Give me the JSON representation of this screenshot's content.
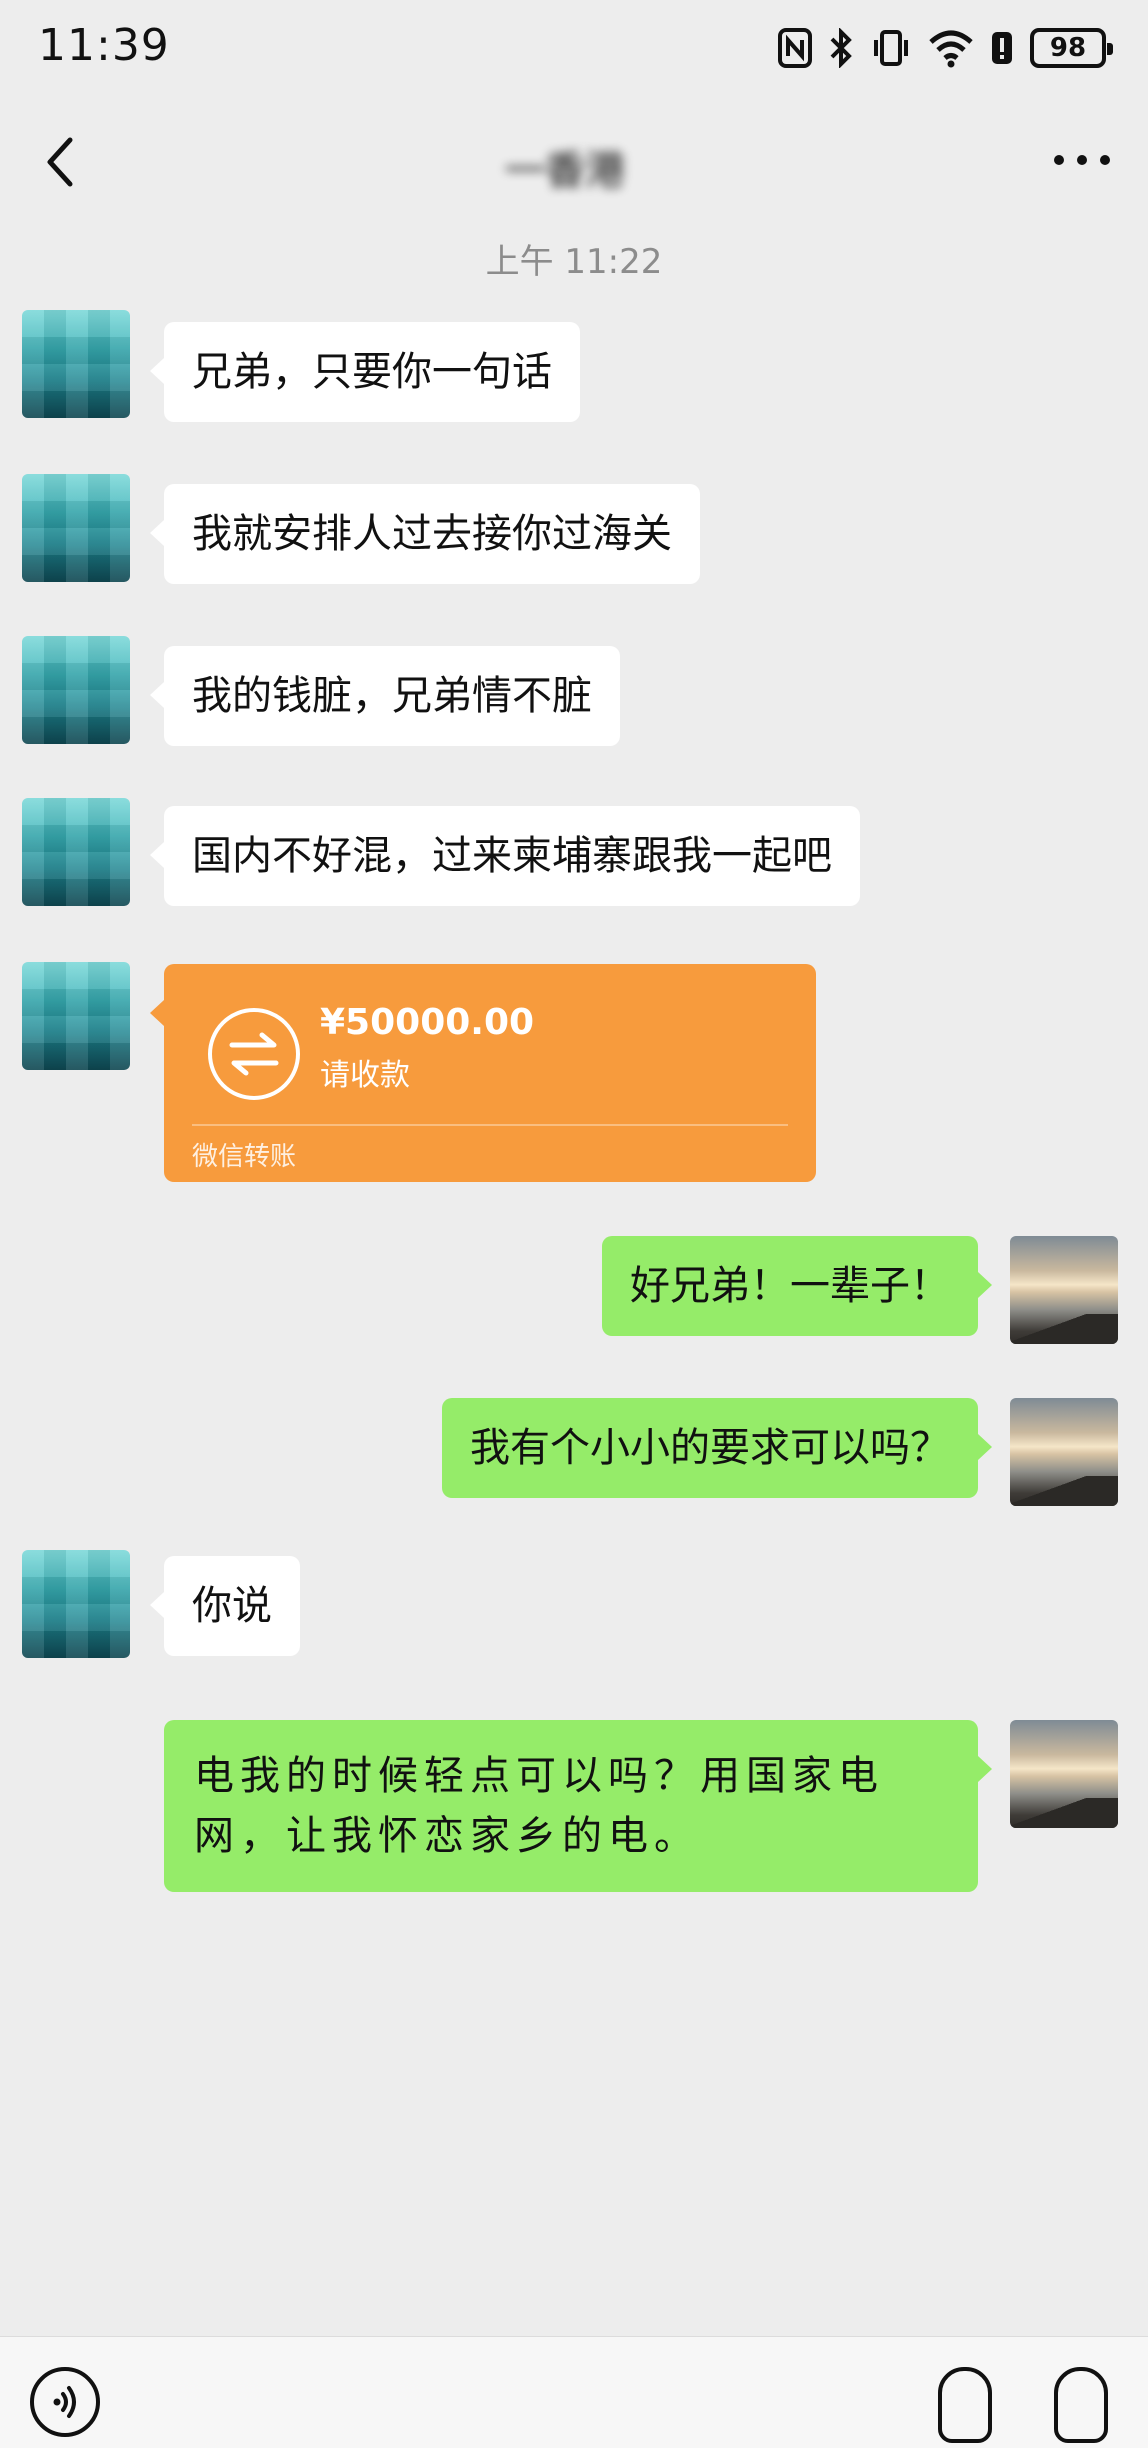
{
  "status_bar": {
    "time": "11:39",
    "battery": "98",
    "icons": [
      "nfc-icon",
      "bluetooth-icon",
      "vibrate-icon",
      "wifi-icon",
      "alert-icon",
      "battery-icon"
    ]
  },
  "nav": {
    "title": "一香港",
    "back_icon": "chevron-left-icon",
    "more_icon": "more-dots-icon"
  },
  "timestamp": "上午 11:22",
  "messages": [
    {
      "side": "left",
      "text": "兄弟，只要你一句话"
    },
    {
      "side": "left",
      "text": "我就安排人过去接你过海关"
    },
    {
      "side": "left",
      "text": "我的钱脏，兄弟情不脏"
    },
    {
      "side": "left",
      "text": "国内不好混，过来柬埔寨跟我一起吧"
    },
    {
      "side": "left",
      "type": "transfer"
    },
    {
      "side": "right",
      "text": "好兄弟！一辈子！"
    },
    {
      "side": "right",
      "text": "我有个小小的要求可以吗？"
    },
    {
      "side": "left",
      "text": "你说"
    },
    {
      "side": "right",
      "text": "电我的时候轻点可以吗？用国家电网，让我怀恋家乡的电。"
    }
  ],
  "transfer": {
    "amount": "¥50000.00",
    "label": "请收款",
    "footer": "微信转账",
    "color": "#f79b3d"
  },
  "colors": {
    "background": "#ededed",
    "bubble_left": "#ffffff",
    "bubble_right": "#95ec69"
  },
  "input_bar": {
    "voice_icon": "voice-icon",
    "emoji_icon": "emoji-icon",
    "plus_icon": "plus-icon"
  }
}
